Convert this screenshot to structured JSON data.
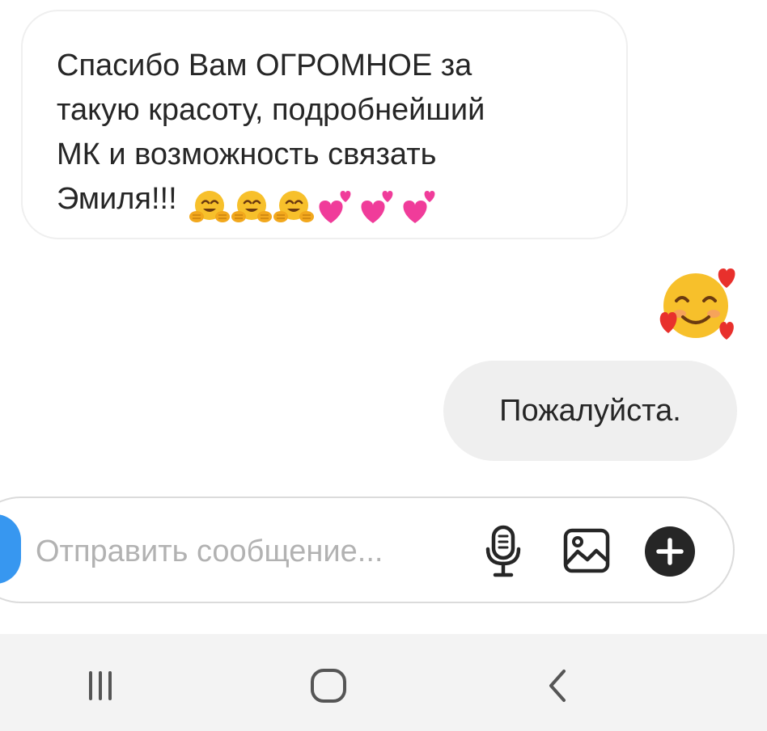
{
  "conversation": {
    "incoming_message": {
      "lines": [
        "Спасибо Вам ОГРОМНОЕ за",
        "такую красоту, подробнейший",
        "МК и возможность связать"
      ],
      "last_line_text": "Эмиля!!!",
      "trailing_emojis": [
        "hugging-face",
        "hugging-face",
        "hugging-face",
        "two-hearts",
        "two-hearts",
        "two-hearts"
      ]
    },
    "reaction_sticker": "smiling-face-with-hearts",
    "outgoing_message": {
      "text": "Пожалуйста."
    }
  },
  "composer": {
    "placeholder": "Отправить сообщение...",
    "value": "",
    "camera_button_color": "#3797f0",
    "icons": [
      "microphone-icon",
      "gallery-icon",
      "plus-circle-icon"
    ]
  },
  "system_nav": {
    "buttons": [
      "recent-apps",
      "home",
      "back"
    ]
  },
  "colors": {
    "text": "#262626",
    "placeholder": "#b2b2b2",
    "outgoing_bubble": "#efefef",
    "bubble_border": "#efefef",
    "navbar_bg": "#f3f3f3"
  }
}
